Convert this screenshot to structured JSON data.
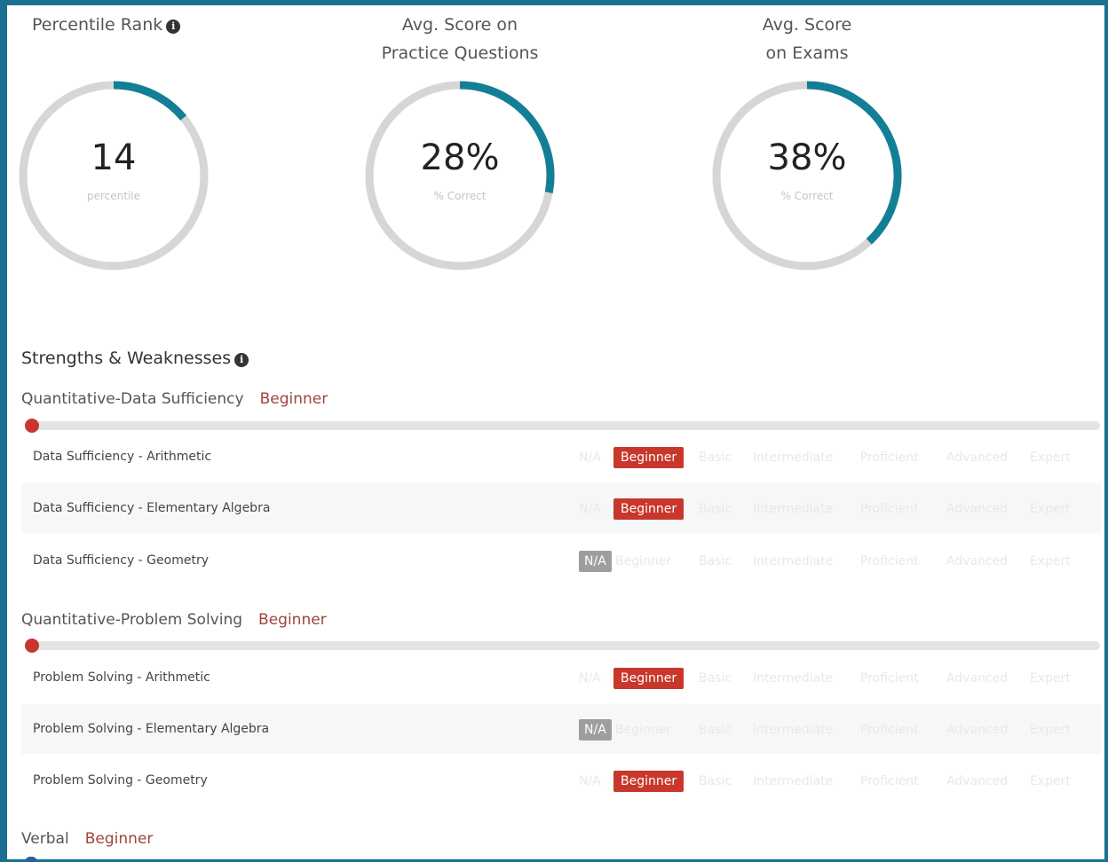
{
  "stats": [
    {
      "title_lines": [
        "Percentile Rank"
      ],
      "has_info": true,
      "value": "14",
      "caption": "percentile",
      "fraction": 0.14
    },
    {
      "title_lines": [
        "Avg. Score on",
        "Practice Questions"
      ],
      "has_info": false,
      "value": "28%",
      "caption": "% Correct",
      "fraction": 0.28
    },
    {
      "title_lines": [
        "Avg. Score",
        "on Exams"
      ],
      "has_info": false,
      "value": "38%",
      "caption": "% Correct",
      "fraction": 0.38
    }
  ],
  "info_glyph": "i",
  "section_title": "Strengths & Weaknesses",
  "level_scale": [
    "N/A",
    "Beginner",
    "Basic",
    "Intermediate",
    "Proficient",
    "Advanced",
    "Expert"
  ],
  "categories": [
    {
      "name": "Quantitative-Data Sufficiency",
      "level": "Beginner",
      "subtopics": [
        {
          "name": "Data Sufficiency - Arithmetic",
          "level": "Beginner"
        },
        {
          "name": "Data Sufficiency - Elementary Algebra",
          "level": "Beginner"
        },
        {
          "name": "Data Sufficiency - Geometry",
          "level": "N/A"
        }
      ]
    },
    {
      "name": "Quantitative-Problem Solving",
      "level": "Beginner",
      "subtopics": [
        {
          "name": "Problem Solving - Arithmetic",
          "level": "Beginner"
        },
        {
          "name": "Problem Solving - Elementary Algebra",
          "level": "N/A"
        },
        {
          "name": "Problem Solving - Geometry",
          "level": "Beginner"
        }
      ]
    },
    {
      "name": "Verbal",
      "level": "Beginner",
      "subtopics": []
    }
  ],
  "colors": {
    "accent": "#137f96",
    "track": "#d6d6d6",
    "beginner": "#c9372c",
    "na": "#9e9e9e",
    "frame": "#1a6f93"
  }
}
